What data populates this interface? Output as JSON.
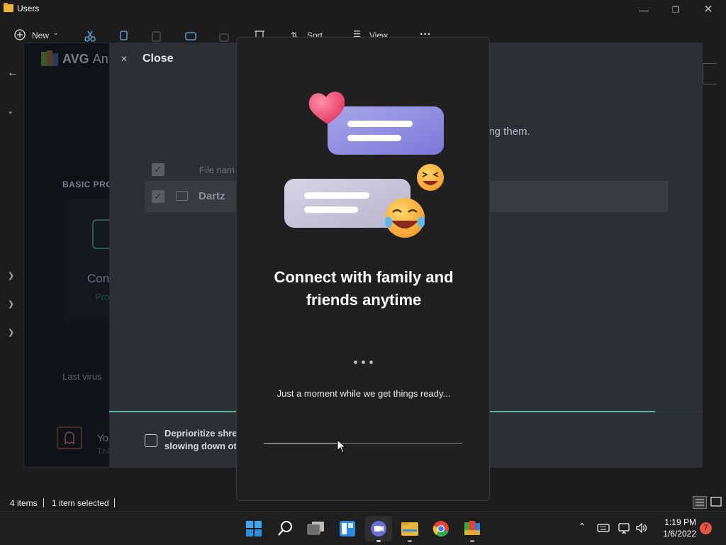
{
  "explorer": {
    "title": "Users",
    "toolbar": {
      "new_label": "New",
      "sort_label": "Sort",
      "view_label": "View",
      "more_label": "···"
    },
    "status": {
      "items": "4 items",
      "selected": "1 item selected"
    }
  },
  "avg": {
    "name": "AVG",
    "name_partial": "An",
    "basic_protection": "BASIC PRO",
    "card_title": "Con",
    "card_sub": "Pro",
    "last_virus": "Last virus",
    "you": "Yo",
    "this": "Thi"
  },
  "shredder": {
    "close_label": "Close",
    "description_partial": "ing them.",
    "column_file_name": "File nam",
    "row_name": "Dartz",
    "deprioritize_line1": "Deprioritize shre",
    "deprioritize_line2": "slowing down ot"
  },
  "dialog": {
    "title_line1": "Connect with family and",
    "title_line2": "friends anytime",
    "message": "Just a moment while we get things ready...",
    "progress": 0.37
  },
  "taskbar": {
    "time": "1:19 PM",
    "date": "1/6/2022",
    "notification_count": "7"
  },
  "colors": {
    "accent_teal": "#4fb7a4",
    "dialog_bg": "#202020",
    "badge": "#e8543f"
  }
}
